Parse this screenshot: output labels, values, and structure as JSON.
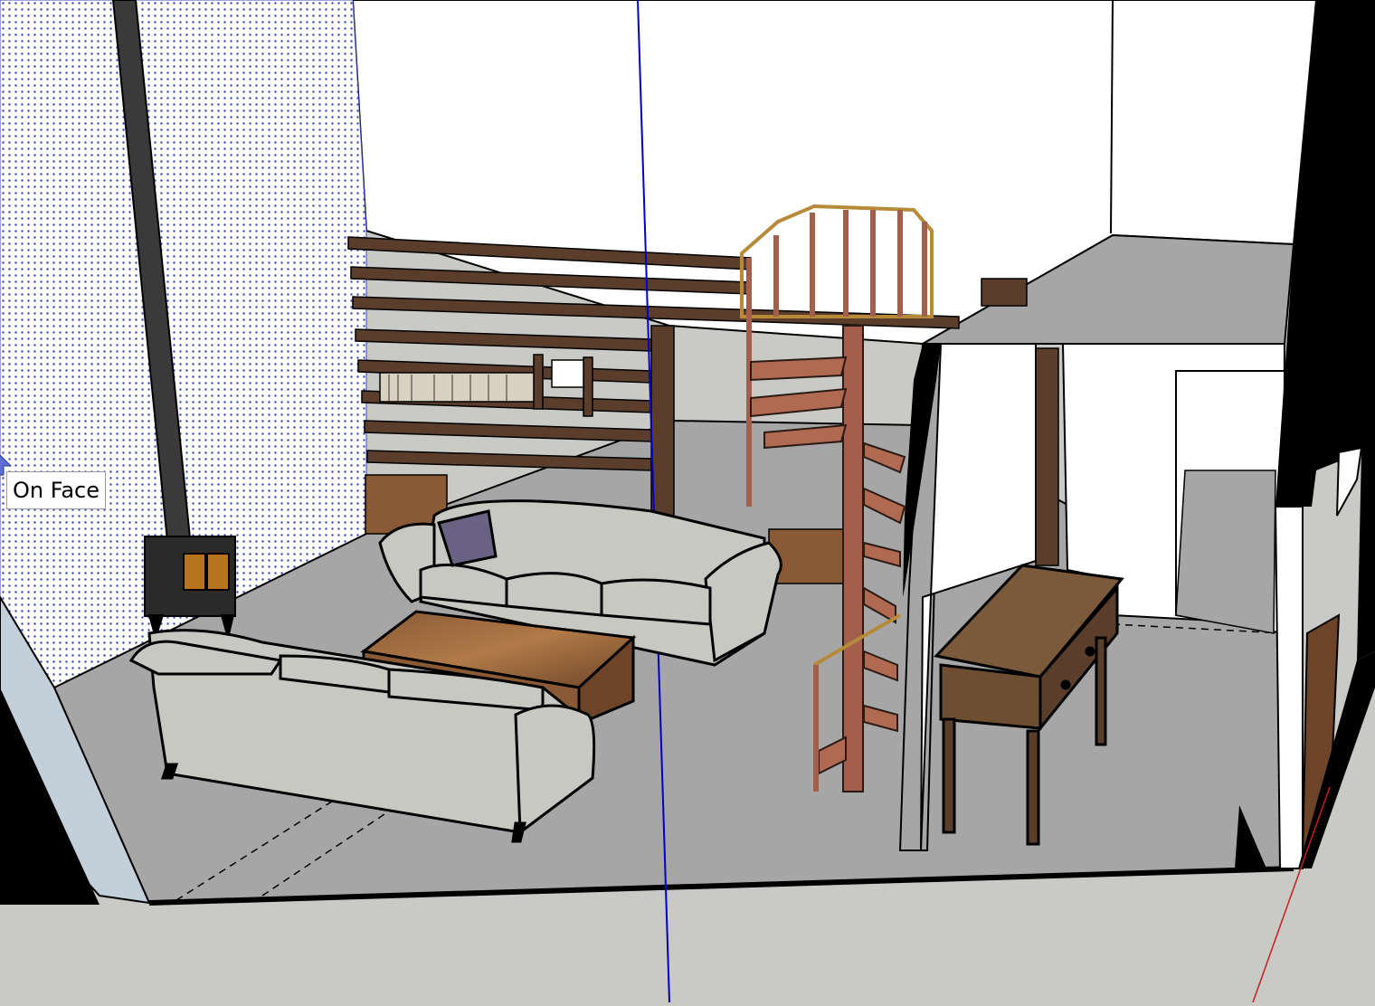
{
  "viewport": {
    "inference_tooltip": "On Face",
    "cursor_icon": "push-pull-cursor-icon",
    "axes": {
      "green": "#0000c8",
      "red": "#c81e1e"
    },
    "colors": {
      "ground": "#c9c9c5",
      "floor": "#a6a6a6",
      "wall": "#ffffff",
      "selected_face_dots": "#3a46b8",
      "wood_dark": "#5a3d2b",
      "stair_wood": "#a45e4c",
      "sofa": "#c8c8c2"
    }
  }
}
